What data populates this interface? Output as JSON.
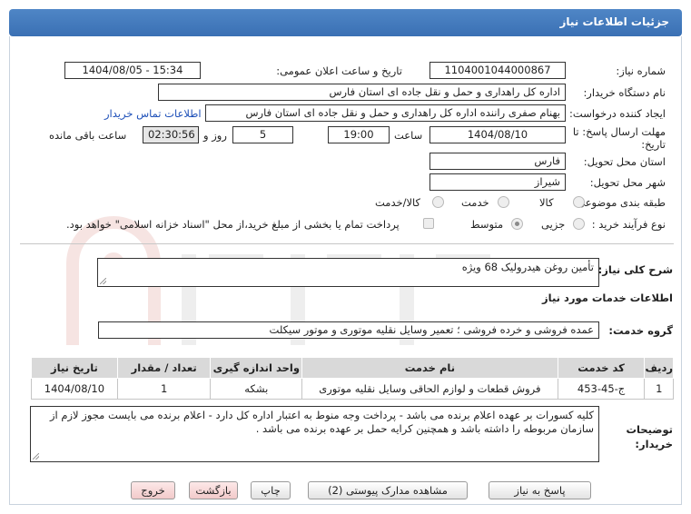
{
  "header": {
    "title": "جزئیات اطلاعات نیاز"
  },
  "form": {
    "need_number": {
      "label": "شماره نیاز:",
      "value": "1104001044000867"
    },
    "announce_datetime": {
      "label": "تاریخ و ساعت اعلان عمومی:",
      "value": "1404/08/05 - 15:34"
    },
    "buyer_org": {
      "label": "نام دستگاه خریدار:",
      "value": "اداره کل راهداری و حمل و نقل جاده ای استان فارس"
    },
    "requester": {
      "label": "ایجاد کننده درخواست:",
      "value": "بهنام صفری راننده اداره کل راهداری و حمل و نقل جاده ای استان فارس",
      "contact_link": "اطلاعات تماس خریدار"
    },
    "deadline": {
      "label_line1": "مهلت ارسال پاسخ: تا",
      "label_line2": "تاریخ:",
      "date": "1404/08/10",
      "time_label": "ساعت",
      "time": "19:00",
      "days": "5",
      "days_label": "روز و",
      "remaining": "02:30:56",
      "remaining_label": "ساعت باقی مانده"
    },
    "province": {
      "label": "استان محل تحویل:",
      "value": "فارس"
    },
    "city": {
      "label": "شهر محل تحویل:",
      "value": "شیراز"
    },
    "category": {
      "label": "طبقه بندی موضوعی:",
      "options": [
        "کالا",
        "خدمت",
        "کالا/خدمت"
      ]
    },
    "purchase_type": {
      "label": "نوع فرآیند خرید :",
      "options": [
        "جزیی",
        "متوسط"
      ],
      "note": "پرداخت تمام یا بخشی از مبلغ خرید،از محل \"اسناد خزانه اسلامی\" خواهد بود."
    }
  },
  "summary": {
    "label": "شرح کلی نیاز:",
    "value": "تأمین روغن هیدرولیک 68 ویژه"
  },
  "services_section": {
    "title": "اطلاعات خدمات مورد نیاز"
  },
  "service_group": {
    "label": "گروه خدمت:",
    "value": "عمده فروشی و خرده فروشی ؛ تعمیر وسایل نقلیه موتوری و موتور سیکلت"
  },
  "table": {
    "headers": [
      "ردیف",
      "کد خدمت",
      "نام خدمت",
      "واحد اندازه گیری",
      "تعداد / مقدار",
      "تاریخ نیاز"
    ],
    "rows": [
      [
        "1",
        "ج-45-453",
        "فروش قطعات و لوازم الحاقی وسایل نقلیه موتوری",
        "بشکه",
        "1",
        "1404/08/10"
      ]
    ]
  },
  "buyer_notes": {
    "label_line1": "توضیحات",
    "label_line2": "خریدار:",
    "value": "کلیه کسورات بر عهده اعلام برنده می باشد - پرداخت وجه منوط به اعتبار اداره کل دارد - اعلام برنده می بایست مجوز لازم از سازمان مربوطه را داشته باشد و همچنین کرایه حمل بر عهده برنده می باشد ."
  },
  "buttons": {
    "reply": "پاسخ به نیاز",
    "attachments": "مشاهده مدارک پیوستی (2)",
    "print": "چاپ",
    "back": "بازگشت",
    "exit": "خروج"
  },
  "colors": {
    "header": "#3f78bc",
    "link": "#1d4fb8"
  }
}
